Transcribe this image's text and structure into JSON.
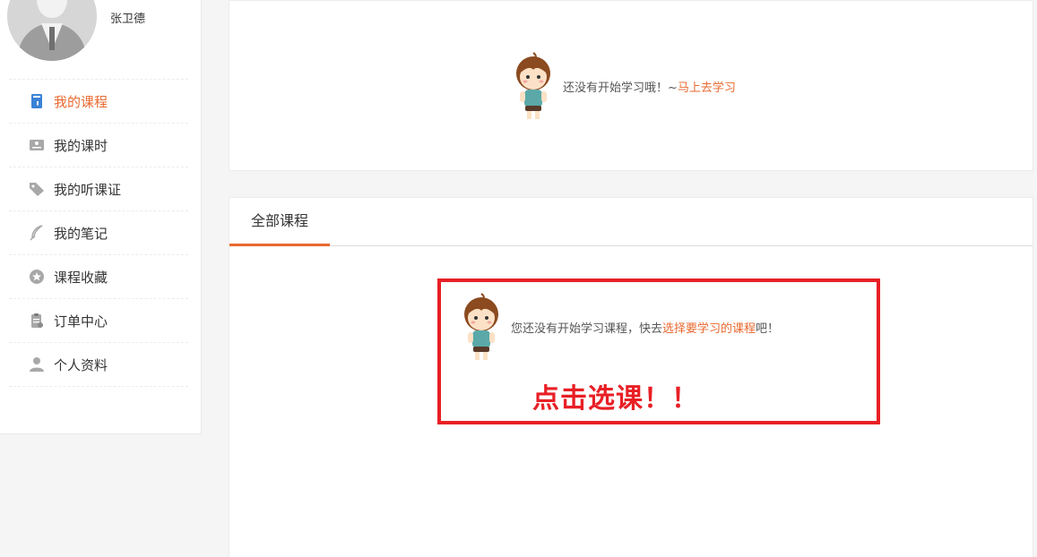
{
  "user": {
    "name": "张卫德"
  },
  "menu": [
    {
      "label": "我的课程",
      "icon": "book-icon",
      "active": true
    },
    {
      "label": "我的课时",
      "icon": "id-card-icon"
    },
    {
      "label": "我的听课证",
      "icon": "tag-icon"
    },
    {
      "label": "我的笔记",
      "icon": "feather-icon"
    },
    {
      "label": "课程收藏",
      "icon": "star-icon"
    },
    {
      "label": "订单中心",
      "icon": "clipboard-icon"
    },
    {
      "label": "个人资料",
      "icon": "user-icon"
    }
  ],
  "study": {
    "text": "还没有开始学习哦！~",
    "link": "马上去学习"
  },
  "courses": {
    "tab": "全部课程",
    "text": "您还没有开始学习课程，快去",
    "link": "选择要学习的课程",
    "suffix": "吧！"
  },
  "annotation": {
    "text": "点击选课！！",
    "color": "#e81f25"
  },
  "colors": {
    "accent": "#e8692f"
  }
}
